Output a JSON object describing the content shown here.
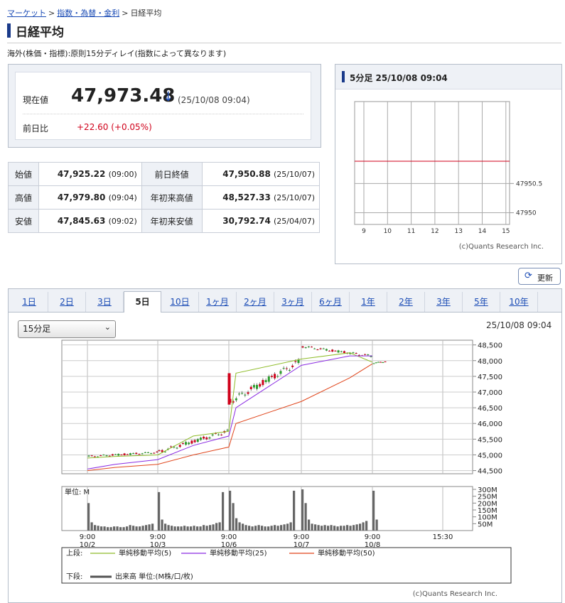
{
  "breadcrumb": {
    "items": [
      "マーケット",
      "指数・為替・金利",
      "日経平均"
    ],
    "sep": ">"
  },
  "page_title": "日経平均",
  "delay_note": "海外(株価・指標):原則15分ディレイ(指数によって異なります)",
  "quote": {
    "price_label": "現在値",
    "price": "47,973.48",
    "arrow": "↓",
    "time": "(25/10/08 09:04)",
    "change_label": "前日比",
    "change": "+22.60 (+0.05%)"
  },
  "ohlc": [
    [
      {
        "label": "始値",
        "value": "47,925.22",
        "time": "(09:00)"
      },
      {
        "label": "前日終値",
        "value": "47,950.88",
        "time": "(25/10/07)"
      }
    ],
    [
      {
        "label": "高値",
        "value": "47,979.80",
        "time": "(09:04)"
      },
      {
        "label": "年初来高値",
        "value": "48,527.33",
        "time": "(25/10/07)"
      }
    ],
    [
      {
        "label": "安値",
        "value": "47,845.63",
        "time": "(09:02)"
      },
      {
        "label": "年初来安値",
        "value": "30,792.74",
        "time": "(25/04/07)"
      }
    ]
  ],
  "mini": {
    "header": "5分足 25/10/08 09:04",
    "credit": "(c)Quants Research Inc."
  },
  "refresh_label": "更新",
  "tabs": {
    "items": [
      "1日",
      "2日",
      "3日",
      "5日",
      "10日",
      "1ヶ月",
      "2ヶ月",
      "3ヶ月",
      "6ヶ月",
      "1年",
      "2年",
      "3年",
      "5年",
      "10年"
    ],
    "active": 3
  },
  "interval_select": {
    "value": "15分足"
  },
  "main_time": "25/10/08 09:04",
  "main_credit": "(c)Quants Research Inc.",
  "legend": {
    "upper_label": "上段:",
    "lower_label": "下段:",
    "lower_item": "出来高 単位:(M株/口/枚)"
  },
  "colors": {
    "up": "#2a9d2a",
    "down": "#d0021b",
    "ma5": "#8fbc2a",
    "ma25": "#8a2be2",
    "ma50": "#e0451b",
    "accent": "#1a3a8a"
  },
  "chart_data": [
    {
      "type": "line",
      "name": "5分足",
      "x_ticks": [
        "9",
        "10",
        "11",
        "12",
        "13",
        "14",
        "15"
      ],
      "y_ticks": [
        47950.5,
        47950.0
      ],
      "ylim": [
        47949.8,
        47951.9
      ],
      "reference_line": 47950.88,
      "grid": true
    },
    {
      "type": "candlestick",
      "x_ticks": [
        {
          "time": "9:00",
          "date": "10/2"
        },
        {
          "time": "9:00",
          "date": "10/3"
        },
        {
          "time": "9:00",
          "date": "10/6"
        },
        {
          "time": "9:00",
          "date": "10/7"
        },
        {
          "time": "9:00",
          "date": "10/8"
        },
        {
          "time": "15:30",
          "date": ""
        }
      ],
      "y_ticks": [
        "48,500",
        "48,000",
        "47,500",
        "47,000",
        "46,500",
        "46,000",
        "45,500",
        "45,000",
        "44,500"
      ],
      "ylim": [
        44400,
        48650
      ],
      "grid": true,
      "series": [
        {
          "name": "単純移動平均(5)",
          "values": [
            44900,
            44950,
            45000,
            45600,
            45750,
            47600,
            48050,
            48250,
            47950
          ]
        },
        {
          "name": "単純移動平均(25)",
          "values": [
            44550,
            44700,
            44850,
            45300,
            45600,
            46500,
            47850,
            48150,
            48150
          ]
        },
        {
          "name": "単純移動平均(50)",
          "values": [
            44500,
            44600,
            44700,
            45000,
            45250,
            46000,
            46700,
            47450,
            47900
          ]
        }
      ],
      "candles_sessions": [
        {
          "date": "10/2",
          "open": 44950,
          "close": 45080,
          "low": 44750,
          "high": 45150
        },
        {
          "date": "10/3",
          "open": 45100,
          "close": 45750,
          "low": 45000,
          "high": 45800
        },
        {
          "date": "10/6",
          "open": 46700,
          "close": 47950,
          "low": 46700,
          "high": 48000
        },
        {
          "date": "10/7",
          "open": 48450,
          "close": 48150,
          "low": 48050,
          "high": 48530
        },
        {
          "date": "10/8",
          "open": 47925,
          "close": 47973,
          "low": 47846,
          "high": 47980
        }
      ]
    },
    {
      "type": "bar",
      "name": "出来高",
      "unit_label": "単位: M",
      "y_ticks": [
        "300M",
        "250M",
        "200M",
        "150M",
        "100M",
        "50M"
      ],
      "ylim": [
        0,
        300
      ],
      "sessions": [
        {
          "date": "10/2",
          "values": [
            200,
            60,
            40,
            35,
            30,
            30,
            25,
            25,
            30,
            30,
            25,
            25,
            30,
            40,
            35,
            30,
            30,
            35,
            40,
            45,
            50
          ]
        },
        {
          "date": "10/3",
          "values": [
            280,
            80,
            50,
            40,
            35,
            30,
            30,
            30,
            35,
            30,
            30,
            35,
            30,
            30,
            40,
            35,
            40,
            45,
            55,
            60,
            280
          ]
        },
        {
          "date": "10/6",
          "values": [
            290,
            200,
            90,
            60,
            50,
            40,
            35,
            30,
            35,
            40,
            35,
            30,
            30,
            35,
            40,
            35,
            40,
            45,
            50,
            60,
            290
          ]
        },
        {
          "date": "10/7",
          "values": [
            300,
            200,
            80,
            50,
            45,
            40,
            35,
            40,
            35,
            40,
            35,
            30,
            35,
            35,
            40,
            35,
            40,
            45,
            50,
            60,
            70
          ]
        },
        {
          "date": "10/8",
          "values": [
            290,
            80
          ]
        }
      ]
    }
  ]
}
